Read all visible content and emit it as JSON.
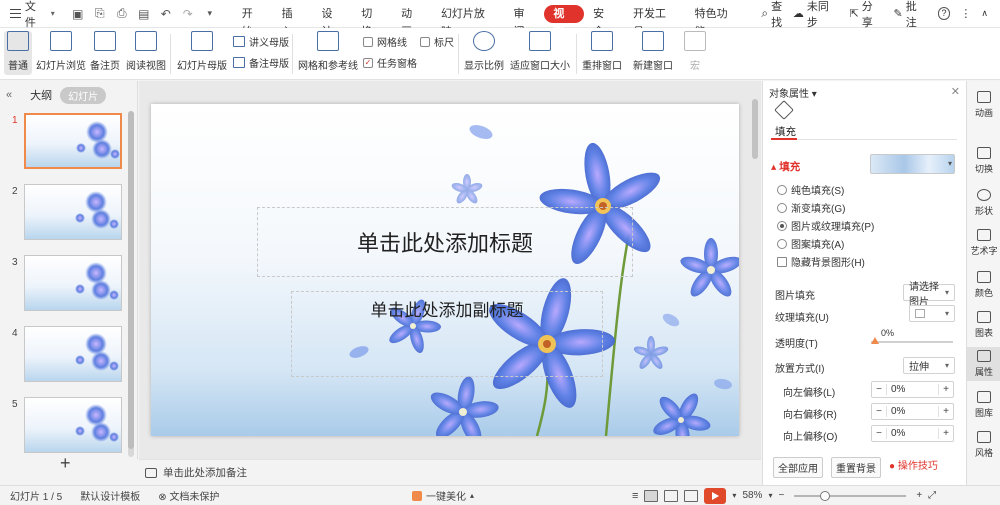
{
  "menubar": {
    "file_label": "文件",
    "tabs": [
      "开始",
      "插入",
      "设计",
      "切换",
      "动画",
      "幻灯片放映",
      "审阅",
      "视图",
      "安全",
      "开发工具",
      "特色功能"
    ],
    "active_tab": "视图",
    "search_label": "查找",
    "sync_label": "未同步",
    "share_label": "分享",
    "comment_label": "批注",
    "accent": "#e0332b"
  },
  "ribbon": {
    "normal": "普通",
    "slide_browse": "幻灯片浏览",
    "notes_page": "备注页",
    "reading_view": "阅读视图",
    "slide_master": "幻灯片母版",
    "handout_master": "讲义母版",
    "notes_master": "备注母版",
    "grid_guides": "网格和参考线",
    "gridlines": "网格线",
    "ruler": "标尺",
    "task_pane": "任务窗格",
    "zoom_ratio": "显示比例",
    "fit_window": "适应窗口大小",
    "arrange_windows": "重排窗口",
    "new_window": "新建窗口",
    "macro": "宏"
  },
  "leftpanel": {
    "outline_tab": "大纲",
    "slides_tab": "幻灯片",
    "slides": [
      "1",
      "2",
      "3",
      "4",
      "5"
    ],
    "active_slide": "1"
  },
  "slide": {
    "title_placeholder": "单击此处添加标题",
    "subtitle_placeholder": "单击此处添加副标题"
  },
  "notes": {
    "placeholder": "单击此处添加备注"
  },
  "properties": {
    "header": "对象属性",
    "fill_tab": "填充",
    "fill_section": "填充",
    "options": [
      "纯色填充(S)",
      "渐变填充(G)",
      "图片或纹理填充(P)",
      "图案填充(A)"
    ],
    "selected_option": "图片或纹理填充(P)",
    "hide_bg": "隐藏背景图形(H)",
    "picture_fill_label": "图片填充",
    "picture_fill_value": "请选择图片",
    "texture_fill_label": "纹理填充(U)",
    "transparency_label": "透明度(T)",
    "transparency_value": "0%",
    "placement_label": "放置方式(I)",
    "placement_value": "拉伸",
    "offset_left_label": "向左偏移(L)",
    "offset_left_value": "0%",
    "offset_right_label": "向右偏移(R)",
    "offset_right_value": "0%",
    "offset_up_label": "向上偏移(O)",
    "offset_up_value": "0%",
    "apply_all": "全部应用",
    "reset_bg": "重置背景",
    "tips": "操作技巧"
  },
  "sidebar": [
    "动画",
    "切换",
    "形状",
    "艺术字",
    "颜色",
    "图表",
    "属性",
    "图库",
    "风格"
  ],
  "statusbar": {
    "slide_counter": "幻灯片 1 / 5",
    "template": "默认设计模板",
    "doc_protect": "文档未保护",
    "beautify": "一键美化",
    "zoom": "58%"
  }
}
